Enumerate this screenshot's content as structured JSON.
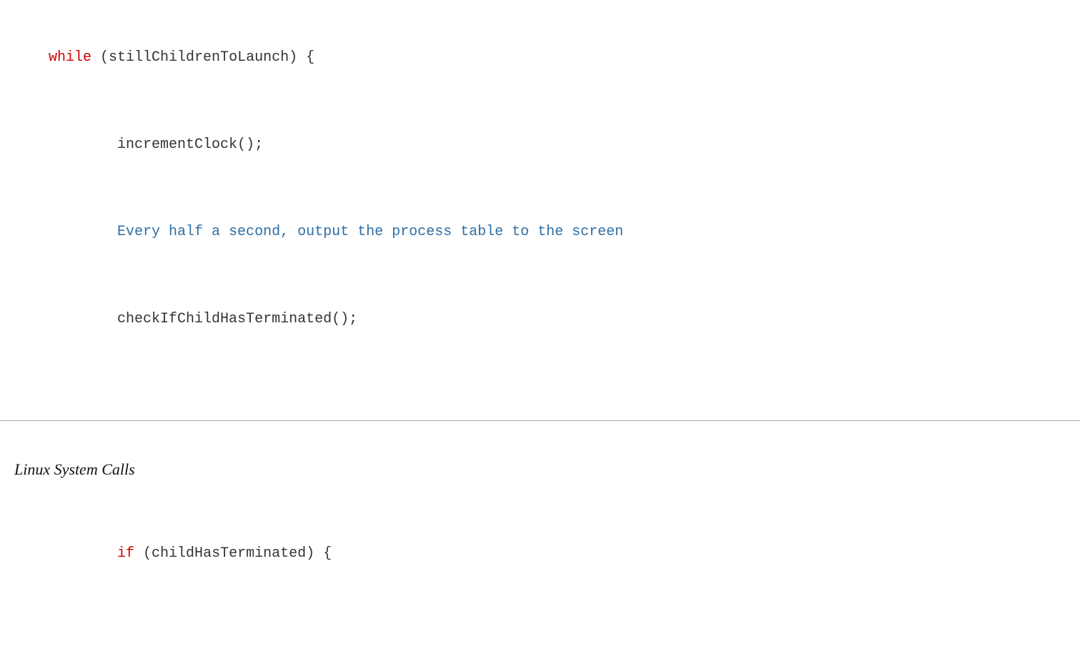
{
  "top_code": {
    "line1": {
      "keyword": "while",
      "rest": " (stillChildrenToLaunch) {"
    },
    "line2": {
      "content": "        incrementClock();"
    },
    "line3": {
      "comment": "        Every half a second, output the process table to the screen"
    },
    "line4": {
      "content": "        checkIfChildHasTerminated();"
    }
  },
  "section_label": "Linux System Calls",
  "bottom_code": {
    "line1": {
      "keyword": "if",
      "rest": " (childHasTerminated) {"
    }
  }
}
